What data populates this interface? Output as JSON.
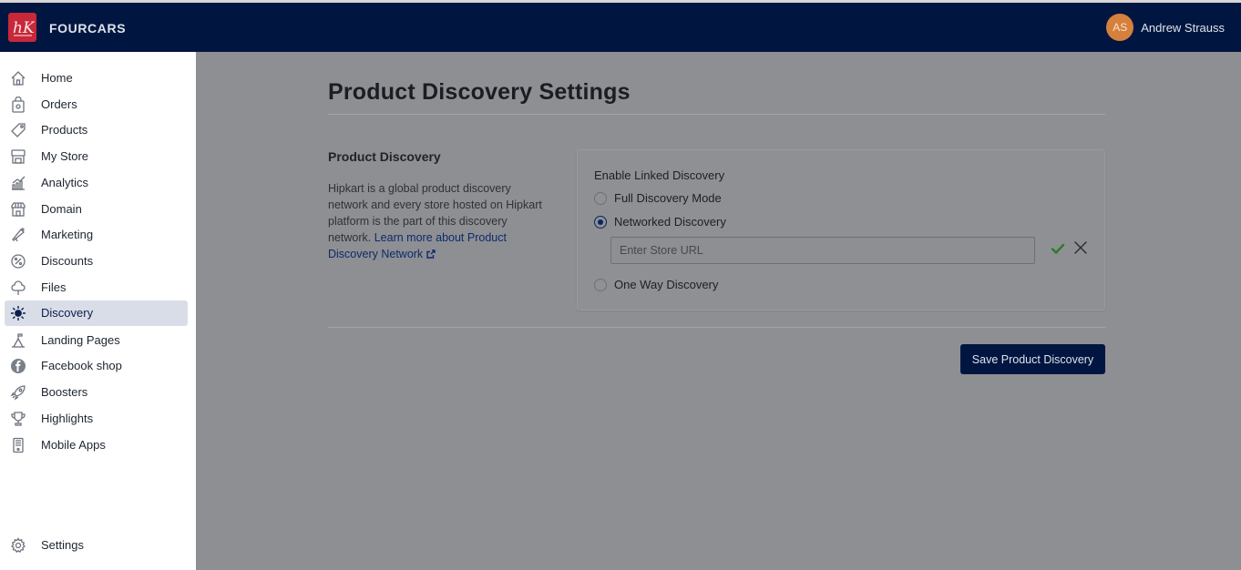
{
  "app": {
    "brand": "FOURCARS",
    "logo_text": "hK",
    "user": {
      "initials": "AS",
      "name": "Andrew Strauss"
    }
  },
  "sidebar": {
    "items": [
      {
        "label": "Home",
        "icon": "home-icon"
      },
      {
        "label": "Orders",
        "icon": "orders-bag-icon"
      },
      {
        "label": "Products",
        "icon": "tag-icon"
      },
      {
        "label": "My Store",
        "icon": "storefront-icon"
      },
      {
        "label": "Analytics",
        "icon": "chart-trend-icon"
      },
      {
        "label": "Domain",
        "icon": "domain-store-icon"
      },
      {
        "label": "Marketing",
        "icon": "megaphone-icon"
      },
      {
        "label": "Discounts",
        "icon": "percent-icon"
      },
      {
        "label": "Files",
        "icon": "cloud-icon"
      },
      {
        "label": "Discovery",
        "icon": "discovery-network-icon",
        "active": true
      },
      {
        "label": "Landing Pages",
        "icon": "landing-pages-icon"
      },
      {
        "label": "Facebook shop",
        "icon": "facebook-icon"
      },
      {
        "label": "Boosters",
        "icon": "rocket-icon"
      },
      {
        "label": "Highlights",
        "icon": "trophy-icon"
      },
      {
        "label": "Mobile Apps",
        "icon": "mobile-icon"
      }
    ],
    "settings": {
      "label": "Settings",
      "icon": "gear-icon"
    }
  },
  "main": {
    "title": "Product Discovery Settings",
    "section": {
      "title": "Product Discovery",
      "description": "Hipkart is a global product discovery network and every store hosted on Hipkart platform is the part of this discovery network.",
      "link_text": "Learn more about Product Discovery Network"
    },
    "card": {
      "label": "Enable Linked Discovery",
      "options": [
        {
          "label": "Full Discovery Mode",
          "checked": false
        },
        {
          "label": "Networked Discovery",
          "checked": true
        },
        {
          "label": "One Way Discovery",
          "checked": false
        }
      ],
      "url_input": {
        "value": "",
        "placeholder": "Enter Store URL"
      }
    },
    "save_label": "Save Product Discovery"
  },
  "colors": {
    "topbar": "#001640",
    "accent": "#0c2560",
    "logo_bg": "#c7283a",
    "avatar_bg": "#d5803c",
    "confirm_green": "#2d7a2d"
  }
}
